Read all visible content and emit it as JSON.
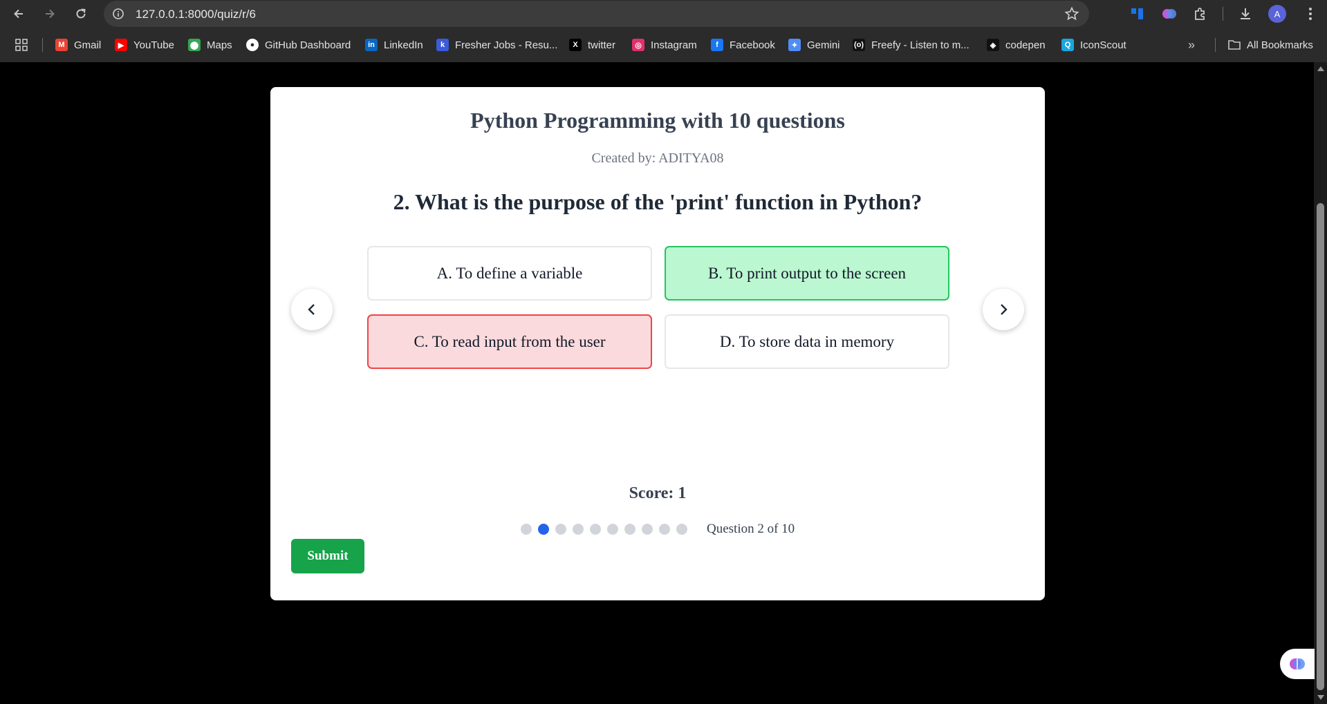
{
  "browser": {
    "url": "127.0.0.1:8000/quiz/r/6",
    "avatar_letter": "A",
    "bookmarks": [
      {
        "label": "Gmail",
        "icon": "gmail-icon",
        "color": "#ea4335",
        "glyph": "M"
      },
      {
        "label": "YouTube",
        "icon": "youtube-icon",
        "color": "#ff0000",
        "glyph": "▶"
      },
      {
        "label": "Maps",
        "icon": "maps-icon",
        "color": "#34a853",
        "glyph": "⬤"
      },
      {
        "label": "GitHub Dashboard",
        "icon": "github-icon",
        "color": "#ffffff",
        "glyph": "●"
      },
      {
        "label": "LinkedIn",
        "icon": "linkedin-icon",
        "color": "#0a66c2",
        "glyph": "in"
      },
      {
        "label": "Fresher Jobs - Resu...",
        "icon": "fresher-jobs-icon",
        "color": "#3b5bdb",
        "glyph": "k"
      },
      {
        "label": "twitter",
        "icon": "x-icon",
        "color": "#000000",
        "glyph": "X"
      },
      {
        "label": "Instagram",
        "icon": "instagram-icon",
        "color": "#e1306c",
        "glyph": "◎"
      },
      {
        "label": "Facebook",
        "icon": "facebook-icon",
        "color": "#1877f2",
        "glyph": "f"
      },
      {
        "label": "Gemini",
        "icon": "gemini-icon",
        "color": "#4f8df5",
        "glyph": "✦"
      },
      {
        "label": "Freefy - Listen to m...",
        "icon": "freefy-icon",
        "color": "#111111",
        "glyph": "(o)"
      },
      {
        "label": "codepen",
        "icon": "codepen-icon",
        "color": "#111111",
        "glyph": "◈"
      },
      {
        "label": "IconScout",
        "icon": "iconscout-icon",
        "color": "#1aa6e0",
        "glyph": "Q"
      }
    ],
    "all_bookmarks_label": "All Bookmarks"
  },
  "quiz": {
    "title": "Python Programming with 10 questions",
    "creator": "Created by: ADITYA08",
    "question": "2. What is the purpose of the 'print' function in Python?",
    "options": [
      {
        "label": "A. To define a variable",
        "state": "neutral"
      },
      {
        "label": "B. To print output to the screen",
        "state": "correct"
      },
      {
        "label": "C. To read input from the user",
        "state": "wrong"
      },
      {
        "label": "D. To store data in memory",
        "state": "neutral"
      }
    ],
    "score": "Score: 1",
    "progress": "Question 2 of 10",
    "current_question": 2,
    "total_questions": 10,
    "submit_label": "Submit"
  },
  "colors": {
    "correct_bg": "#bbf7d0",
    "correct_border": "#22c55e",
    "wrong_bg": "#fadadd",
    "wrong_border": "#ef4444",
    "active_dot": "#2563eb",
    "submit_bg": "#16a34a"
  }
}
